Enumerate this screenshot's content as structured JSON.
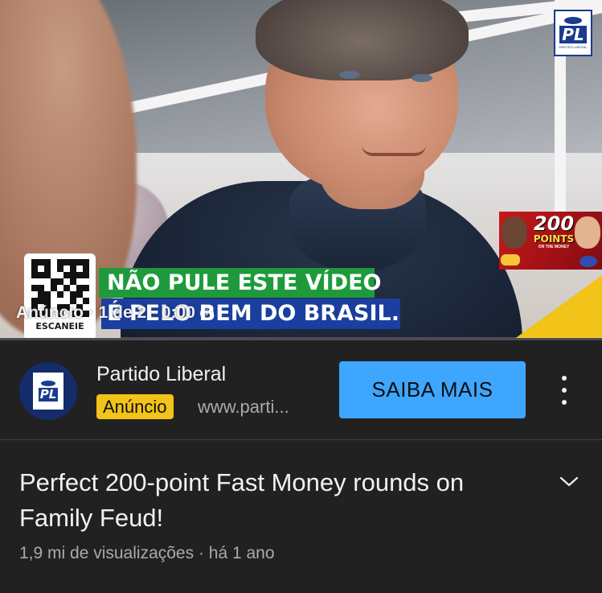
{
  "player": {
    "corner_logo_text": "PL",
    "corner_logo_small": "PARTIDO LIBERAL",
    "qr_label": "ESCANEIE",
    "banner_line1": "NÃO PULE ESTE VÍDEO",
    "banner_line2": "É PELO BEM DO BRASIL.",
    "ad_overlay_text": "Anúncio · 1 de 2 · 0:00",
    "thumbnail_big": "200",
    "thumbnail_small": "POINTS",
    "thumbnail_tiny": "ON THE MONEY",
    "progress": 0.0,
    "accent_color": "#f6c83e"
  },
  "ad": {
    "avatar_text": "PL",
    "advertiser_name": "Partido Liberal",
    "badge_label": "Anúncio",
    "url": "www.parti...",
    "cta_label": "SAIBA MAIS",
    "cta_color": "#3ea6ff",
    "badge_color": "#f2c318",
    "more_icon": "more-vert-icon"
  },
  "video": {
    "title": "Perfect 200-point Fast Money rounds on Family Feud!",
    "views": "1,9 mi de visualizações",
    "separator": "·",
    "age": "há 1 ano",
    "expand_icon": "chevron-down-icon"
  }
}
